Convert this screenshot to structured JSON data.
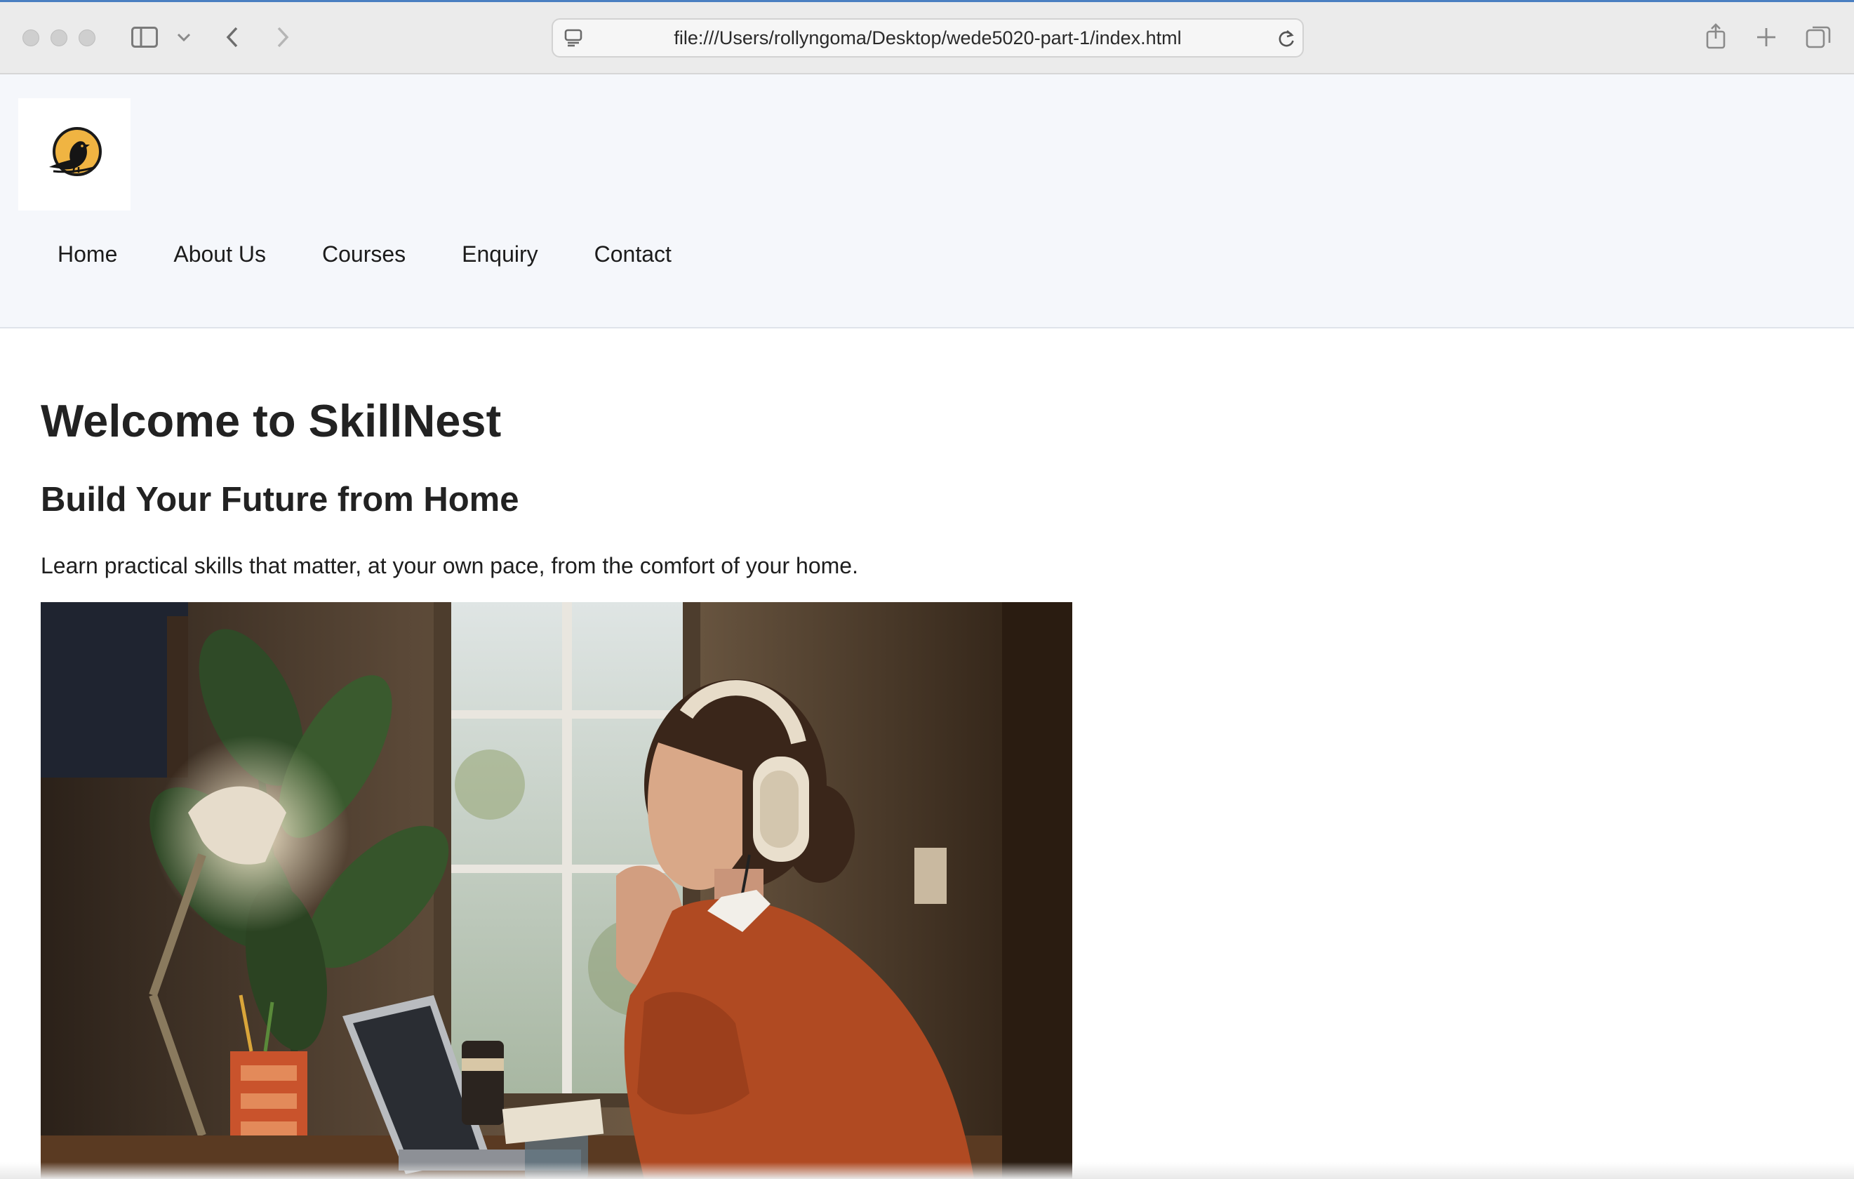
{
  "browser": {
    "url": "file:///Users/rollyngoma/Desktop/wede5020-part-1/index.html"
  },
  "header": {
    "logo_name": "bird-logo",
    "nav": [
      {
        "label": "Home"
      },
      {
        "label": "About Us"
      },
      {
        "label": "Courses"
      },
      {
        "label": "Enquiry"
      },
      {
        "label": "Contact"
      }
    ]
  },
  "main": {
    "title": "Welcome to SkillNest",
    "subtitle": "Build Your Future from Home",
    "lead": "Learn practical skills that matter, at your own pace, from the comfort of your home.",
    "hero_image": "woman-studying-with-headphones-at-laptop"
  },
  "colors": {
    "header_bg": "#f5f7fb",
    "text": "#222222",
    "logo_circle": "#f0b442"
  }
}
